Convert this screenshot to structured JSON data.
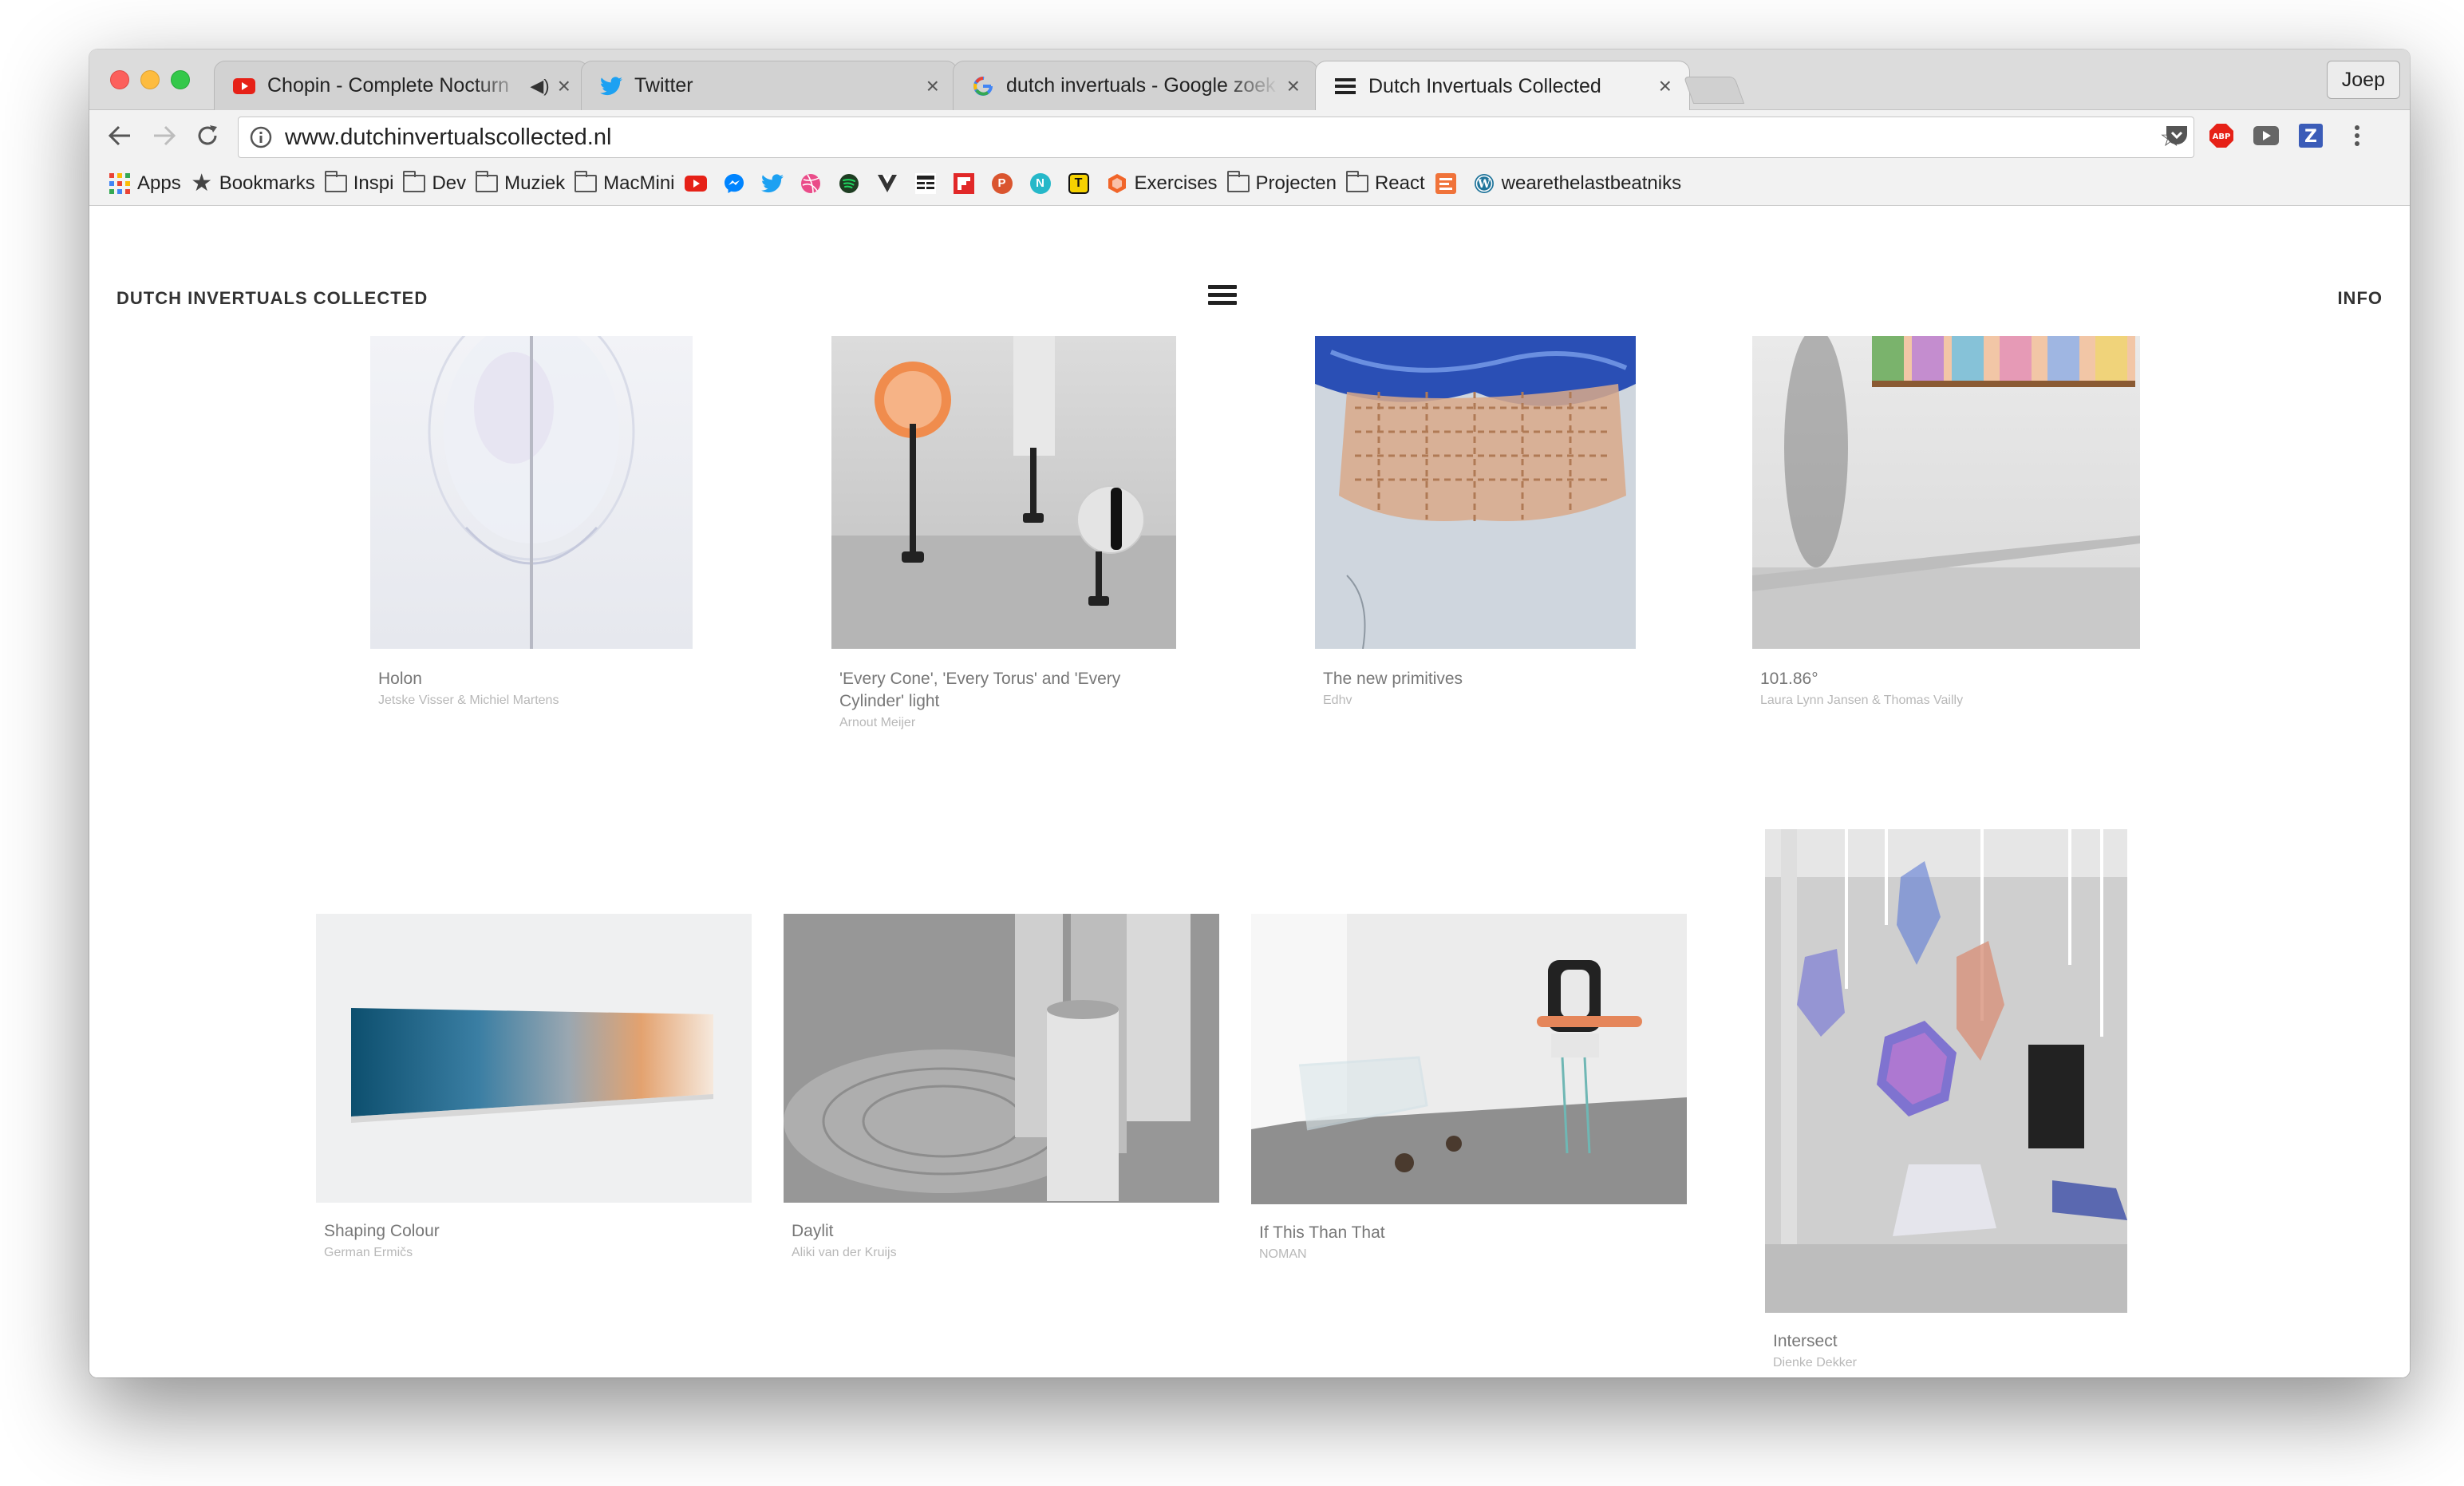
{
  "browser": {
    "tabs": [
      {
        "title": "Chopin - Complete Nocturn",
        "favicon": "youtube-icon",
        "audio": true
      },
      {
        "title": "Twitter",
        "favicon": "twitter-icon"
      },
      {
        "title": "dutch invertuals - Google zoek",
        "favicon": "google-icon"
      },
      {
        "title": "Dutch Invertuals Collected",
        "favicon": "menu-icon",
        "active": true
      }
    ],
    "close_glyph": "×",
    "speaker_glyph": "◀)",
    "profile": "Joep",
    "url": "www.dutchinvertualscollected.nl",
    "star_glyph": "☆",
    "bookmarks": {
      "apps": "Apps",
      "bookmarks": "Bookmarks",
      "inspi": "Inspi",
      "dev": "Dev",
      "muziek": "Muziek",
      "macmini": "MacMini",
      "exercises": "Exercises",
      "projecten": "Projecten",
      "react": "React",
      "beatniks": "wearethelastbeatniks"
    }
  },
  "site": {
    "title": "DUTCH INVERTUALS COLLECTED",
    "info": "INFO"
  },
  "items": [
    {
      "title": "Holon",
      "author": "Jetske Visser & Michiel Martens"
    },
    {
      "title": "'Every Cone', 'Every Torus' and 'Every",
      "title2": "Cylinder' light",
      "author": "Arnout Meijer"
    },
    {
      "title": "The new primitives",
      "author": "Edhv"
    },
    {
      "title": "101.86°",
      "author": "Laura Lynn Jansen & Thomas Vailly"
    },
    {
      "title": "Shaping Colour",
      "author": "German Ermičs"
    },
    {
      "title": "Daylit",
      "author": "Aliki van der Kruijs"
    },
    {
      "title": "If This Than That",
      "author": "NOMAN"
    },
    {
      "title": "Intersect",
      "author": "Dienke Dekker"
    }
  ],
  "colors": {
    "youtube_red": "#e62117",
    "twitter_blue": "#1da1f2",
    "caption_grey": "#777777",
    "author_grey": "#b8b8b8"
  }
}
